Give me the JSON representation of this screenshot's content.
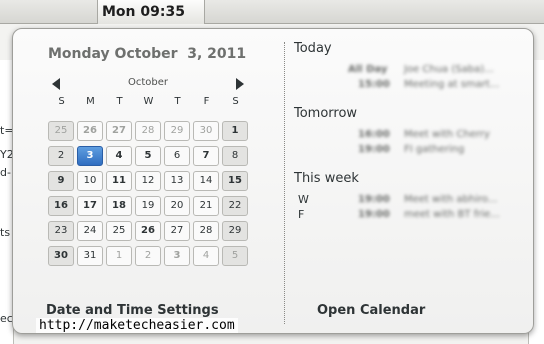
{
  "panel": {
    "clock": "Mon 09:35"
  },
  "calendar": {
    "date_title": "Monday October  3, 2011",
    "month": "October",
    "weekdays": [
      "S",
      "M",
      "T",
      "W",
      "T",
      "F",
      "S"
    ],
    "weeks": [
      [
        "25",
        "26",
        "27",
        "28",
        "29",
        "30",
        "1"
      ],
      [
        "2",
        "3",
        "4",
        "5",
        "6",
        "7",
        "8"
      ],
      [
        "9",
        "10",
        "11",
        "12",
        "13",
        "14",
        "15"
      ],
      [
        "16",
        "17",
        "18",
        "19",
        "20",
        "21",
        "22"
      ],
      [
        "23",
        "24",
        "25",
        "26",
        "27",
        "28",
        "29"
      ],
      [
        "30",
        "31",
        "1",
        "2",
        "3",
        "4",
        "5"
      ]
    ]
  },
  "agenda": {
    "today_label": "Today",
    "today_events": [
      {
        "time": "All Day",
        "desc": "Joe Chua (Saba)..."
      },
      {
        "time": "15:00",
        "desc": "Meeting at smart..."
      }
    ],
    "tomorrow_label": "Tomorrow",
    "tomorrow_events": [
      {
        "time": "16:00",
        "desc": "Meet with Cherry"
      },
      {
        "time": "19:00",
        "desc": "FI gathering"
      }
    ],
    "week_label": "This week",
    "week_events": [
      {
        "day": "W",
        "time": "19:00",
        "desc": "Meet with abhiro..."
      },
      {
        "day": "F",
        "time": "19:00",
        "desc": "meet with BT frie..."
      }
    ]
  },
  "footer": {
    "settings_label": "Date and Time Settings",
    "open_calendar_label": "Open Calendar"
  },
  "watermark": "http://maketecheasier.com",
  "background_fragments": [
    "t=",
    "Y2",
    "d-",
    "ts",
    "ec"
  ],
  "colors": {
    "today_bg": "#3a7ad0",
    "accent_text": "#6e706e"
  }
}
